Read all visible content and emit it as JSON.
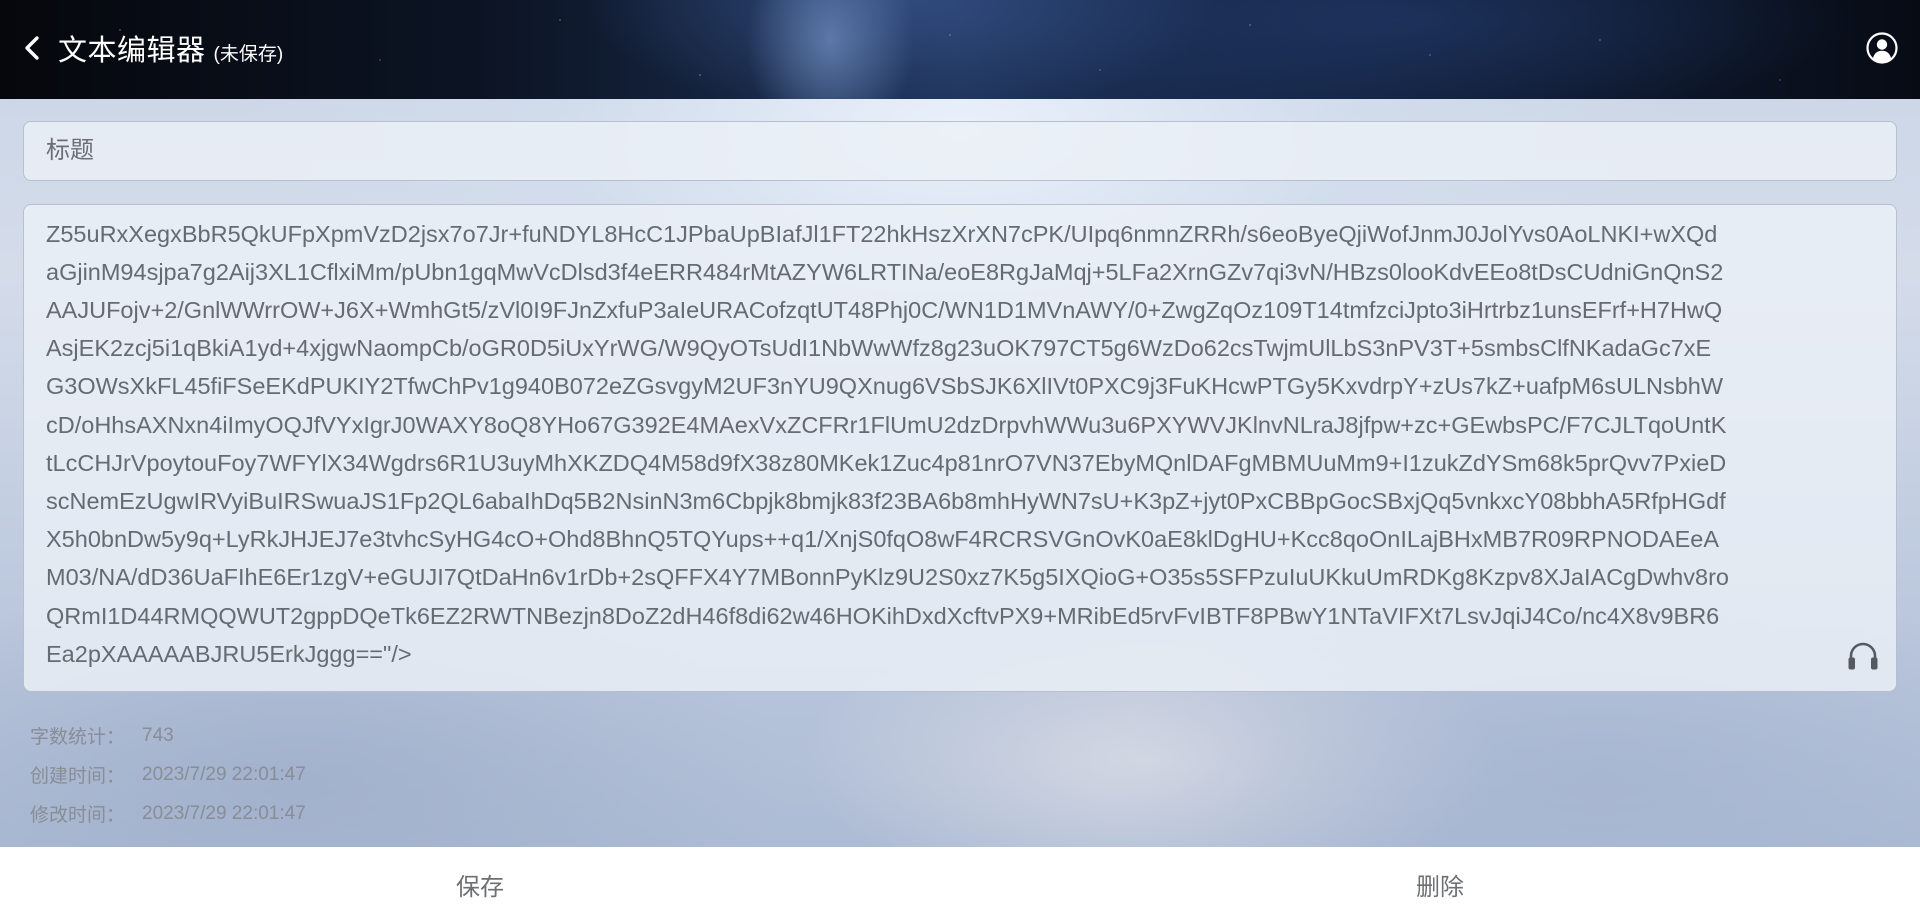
{
  "header": {
    "back_icon": "chevron-left-icon",
    "title": "文本编辑器",
    "save_state": "(未保存)",
    "user_icon": "user-circle-icon"
  },
  "editor": {
    "title_placeholder": "标题",
    "title_value": "",
    "content_lines": [
      "Z55uRxXegxBbR5QkUFpXpmVzD2jsx7o7Jr+fuNDYL8HcC1JPbaUpBIafJl1FT22hkHszXrXN7cPK/UIpq6nmnZRRh/s6eoByeQjiWofJnmJ0JolYvs0AoLNKI+wXQd",
      "aGjinM94sjpa7g2Aij3XL1CflxiMm/pUbn1gqMwVcDlsd3f4eERR484rMtAZYW6LRTINa/eoE8RgJaMqj+5LFa2XrnGZv7qi3vN/HBzs0looKdvEEo8tDsCUdniGnQnS2",
      "AAJUFojv+2/GnlWWrrOW+J6X+WmhGt5/zVl0I9FJnZxfuP3aIeURACofzqtUT48Phj0C/WN1D1MVnAWY/0+ZwgZqOz109T14tmfzciJpto3iHrtrbz1unsEFrf+H7HwQ",
      "AsjEK2zcj5i1qBkiA1yd+4xjgwNaompCb/oGR0D5iUxYrWG/W9QyOTsUdI1NbWwWfz8g23uOK797CT5g6WzDo62csTwjmUlLbS3nPV3T+5smbsClfNKadaGc7xE",
      "G3OWsXkFL45fiFSeEKdPUKIY2TfwChPv1g940B072eZGsvgyM2UF3nYU9QXnug6VSbSJK6XlIVt0PXC9j3FuKHcwPTGy5KxvdrpY+zUs7kZ+uafpM6sULNsbhW",
      "cD/oHhsAXNxn4iImyOQJfVYxIgrJ0WAXY8oQ8YHo67G392E4MAexVxZCFRr1FlUmU2dzDrpvhWWu3u6PXYWVJKlnvNLraJ8jfpw+zc+GEwbsPC/F7CJLTqoUntK",
      "tLcCHJrVpoytouFoy7WFYlX34Wgdrs6R1U3uyMhXKZDQ4M58d9fX38z80MKek1Zuc4p81nrO7VN37EbyMQnlDAFgMBMUuMm9+I1zukZdYSm68k5prQvv7PxieD",
      "scNemEzUgwIRVyiBuIRSwuaJS1Fp2QL6abaIhDq5B2NsinN3m6Cbpjk8bmjk83f23BA6b8mhHyWN7sU+K3pZ+jyt0PxCBBpGocSBxjQq5vnkxcY08bbhA5RfpHGdf",
      "X5h0bnDw5y9q+LyRkJHJEJ7e3tvhcSyHG4cO+Ohd8BhnQ5TQYups++q1/XnjS0fqO8wF4RCRSVGnOvK0aE8klDgHU+Kcc8qoOnILajBHxMB7R09RPNODAEeA",
      "M03/NA/dD36UaFIhE6Er1zgV+eGUJI7QtDaHn6v1rDb+2sQFFX4Y7MBonnPyKlz9U2S0xz7K5g5IXQioG+O35s5SFPzuIuUKkuUmRDKg8Kzpv8XJaIACgDwhv8ro",
      "QRmI1D44RMQQWUT2gppDQeTk6EZ2RWTNBezjn8DoZ2dH46f8di62w46HOKihDxdXcftvPX9+MRibEd5rvFvIBTF8PBwY1NTaVIFXt7LsvJqiJ4Co/nc4X8v9BR6",
      "Ea2pXAAAAABJRU5ErkJggg==\"/>"
    ],
    "headset_icon": "headphones-icon"
  },
  "stats": {
    "word_count_label": "字数统计：",
    "word_count": "743",
    "created_label": "创建时间：",
    "created_time": "2023/7/29 22:01:47",
    "modified_label": "修改时间：",
    "modified_time": "2023/7/29 22:01:47"
  },
  "actions": {
    "save_label": "保存",
    "delete_label": "删除"
  }
}
